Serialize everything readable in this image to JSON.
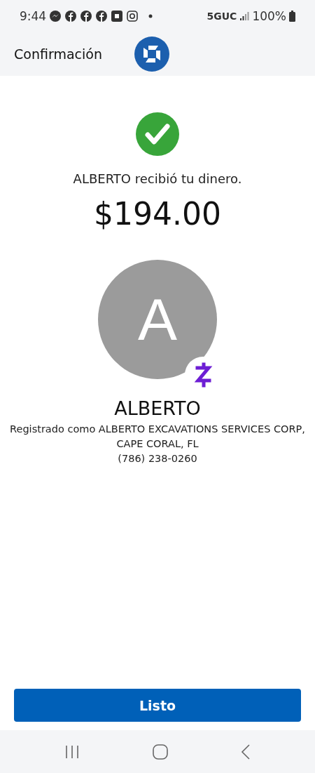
{
  "status_bar": {
    "time": "9:44",
    "network": "5GUC",
    "battery": "100%"
  },
  "app_bar": {
    "title": "Confirmación"
  },
  "confirmation": {
    "message": "ALBERTO recibió tu dinero.",
    "amount": "$194.00"
  },
  "recipient": {
    "initial": "A",
    "name": "ALBERTO",
    "registered_as": "Registrado como ALBERTO EXCAVATIONS SERVICES CORP,",
    "location": "CAPE CORAL, FL",
    "phone": "(786) 238-0260"
  },
  "primary_button": {
    "label": "Listo"
  }
}
